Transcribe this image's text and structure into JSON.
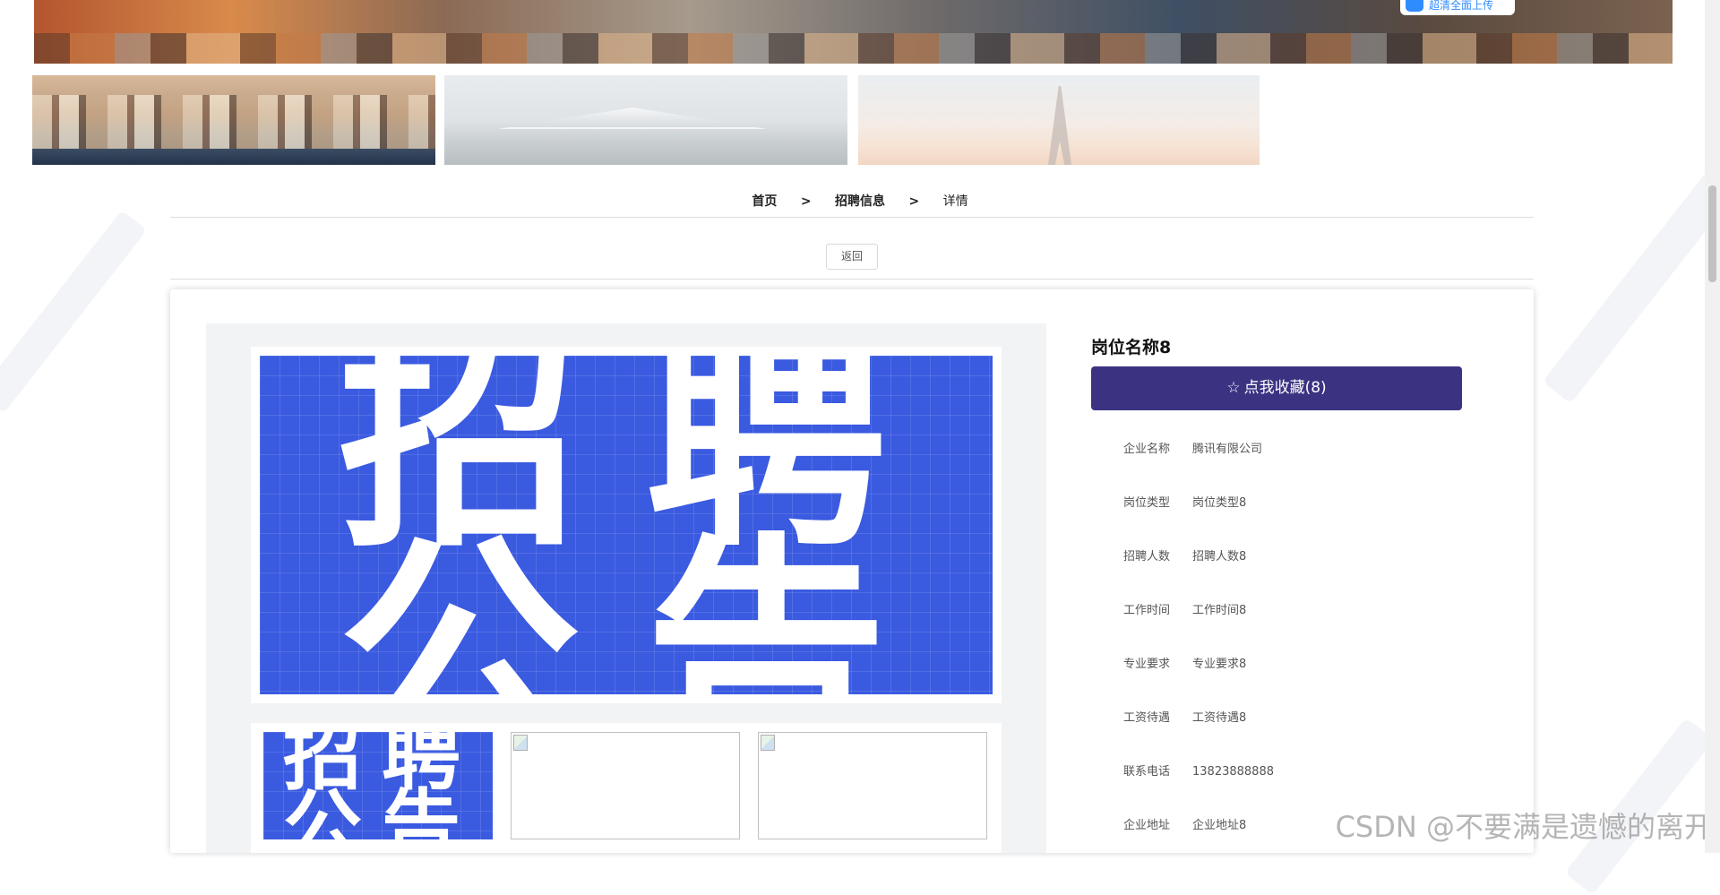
{
  "hero": {
    "button_text": "超清全面上传"
  },
  "breadcrumb": {
    "home": "首页",
    "separator": ">",
    "section": "招聘信息",
    "current": "详情"
  },
  "back_button": "返回",
  "poster": {
    "char1": "招",
    "char2": "聘",
    "char3": "公",
    "char4": "告"
  },
  "job": {
    "title": "岗位名称8",
    "favorite_button": "点我收藏(8)",
    "fields": [
      {
        "label": "企业名称",
        "value": "腾讯有限公司"
      },
      {
        "label": "岗位类型",
        "value": "岗位类型8"
      },
      {
        "label": "招聘人数",
        "value": "招聘人数8"
      },
      {
        "label": "工作时间",
        "value": "工作时间8"
      },
      {
        "label": "专业要求",
        "value": "专业要求8"
      },
      {
        "label": "工资待遇",
        "value": "工资待遇8"
      },
      {
        "label": "联系电话",
        "value": "13823888888"
      },
      {
        "label": "企业地址",
        "value": "企业地址8"
      }
    ]
  },
  "watermark": "CSDN @不要满是遗憾的离开",
  "colors": {
    "accent": "#3b3382",
    "poster_blue": "#3a5ae0",
    "hero_button_blue": "#2f8cff"
  },
  "icons": {
    "favorite": "star-outline-icon"
  }
}
